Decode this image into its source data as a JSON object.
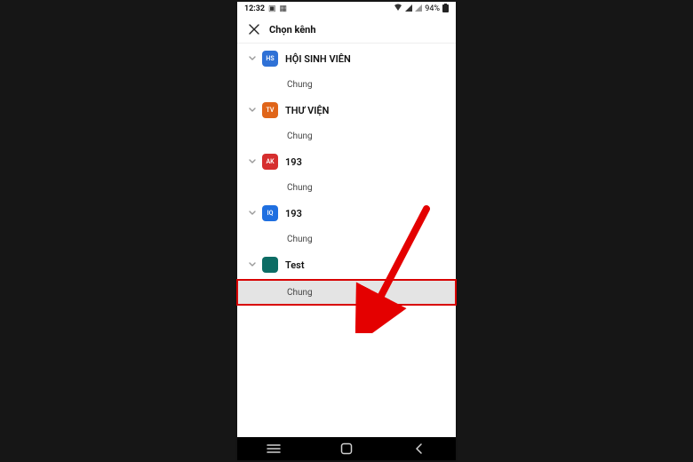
{
  "status_bar": {
    "time": "12:32",
    "battery": "94%"
  },
  "header": {
    "title": "Chọn kênh"
  },
  "groups": [
    {
      "initials": "HS",
      "color": "#2f71d6",
      "name": "HỘI SINH VIÊN",
      "channel": "Chung"
    },
    {
      "initials": "TV",
      "color": "#e06519",
      "name": "THƯ VIỆN",
      "channel": "Chung"
    },
    {
      "initials": "AK",
      "color": "#d62e2e",
      "name": "193",
      "channel": "Chung"
    },
    {
      "initials": "IQ",
      "color": "#1f6fe0",
      "name": "193",
      "channel": "Chung"
    },
    {
      "initials": "",
      "color": "#0c6c64",
      "name": "Test",
      "channel": "Chung",
      "highlight": true
    }
  ]
}
